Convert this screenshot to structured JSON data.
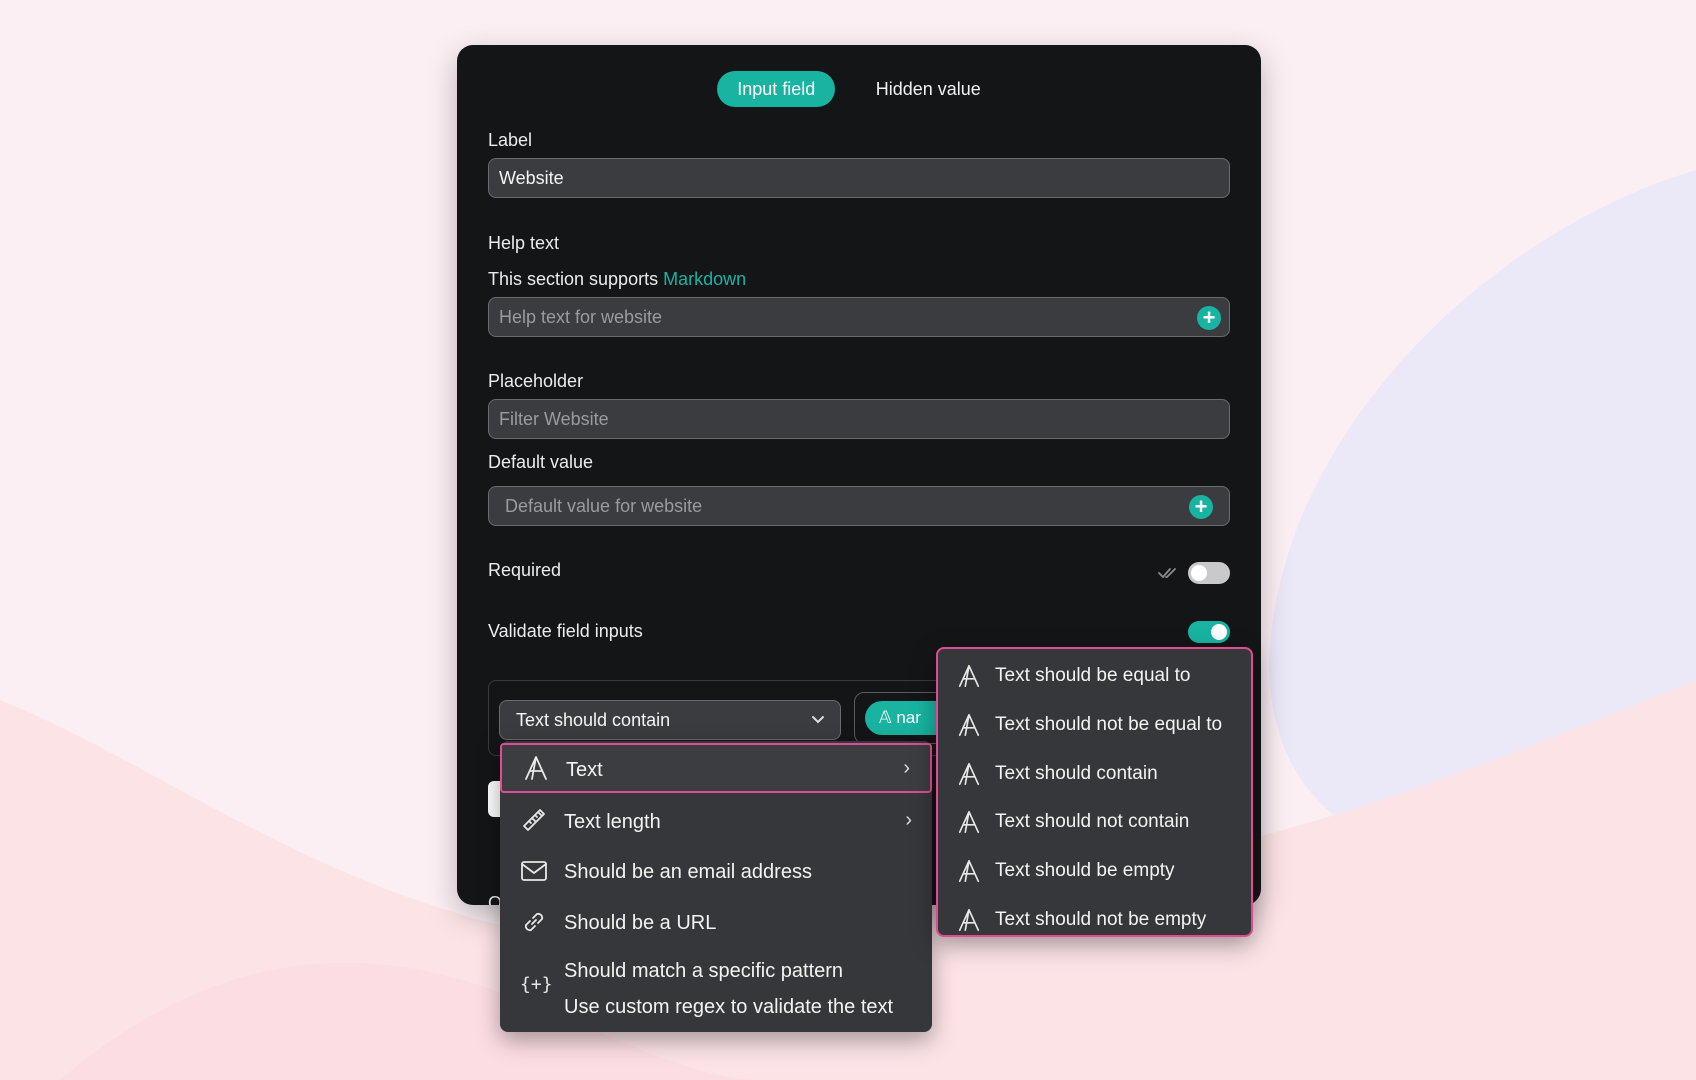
{
  "tabs": {
    "input_field": "Input field",
    "hidden_value": "Hidden value"
  },
  "label": {
    "title": "Label",
    "value": "Website"
  },
  "help_text": {
    "title": "Help text",
    "supports_prefix": "This section supports",
    "markdown_link": "Markdown",
    "placeholder": "Help text for website"
  },
  "placeholder_section": {
    "title": "Placeholder",
    "placeholder": "Filter Website"
  },
  "default_value": {
    "title": "Default value",
    "placeholder": "Default value for website"
  },
  "required": {
    "title": "Required",
    "enabled": false
  },
  "validate": {
    "title": "Validate field inputs",
    "enabled": true
  },
  "condition": {
    "selected": "Text should contain",
    "chip_text": "nar"
  },
  "partial_text": {
    "o": "O"
  },
  "menu": {
    "items": [
      {
        "icon": "text-a-icon",
        "label": "Text",
        "has_submenu": true
      },
      {
        "icon": "ruler-icon",
        "label": "Text length",
        "has_submenu": true
      },
      {
        "icon": "envelope-icon",
        "label": "Should be an email address"
      },
      {
        "icon": "link-icon",
        "label": "Should be a URL"
      },
      {
        "icon": "regex-icon",
        "label": "Should match a specific pattern",
        "sublabel": "Use custom regex to validate the text"
      }
    ]
  },
  "submenu": {
    "items": [
      {
        "label": "Text should be equal to"
      },
      {
        "label": "Text should not be equal to"
      },
      {
        "label": "Text should contain"
      },
      {
        "label": "Text should not contain"
      },
      {
        "label": "Text should be empty"
      },
      {
        "label": "Text should not be empty"
      }
    ]
  },
  "colors": {
    "accent": "#19b3a1",
    "highlight": "#e04b93",
    "panel": "#141517"
  }
}
